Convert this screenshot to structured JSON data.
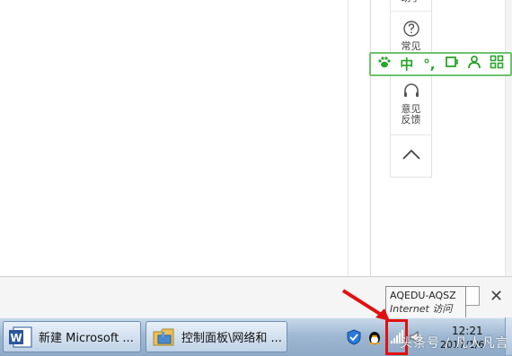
{
  "side_toolbar": {
    "top_partial_label": "助手",
    "faq_label": "常见",
    "feedback_label_line1": "意见",
    "feedback_label_line2": "反馈"
  },
  "ime_bar": {
    "items": [
      {
        "icon": "paw-icon",
        "text": "🐾"
      },
      {
        "icon": "chinese-mode",
        "text": "中"
      },
      {
        "icon": "punctuation-mode",
        "text": "°,"
      },
      {
        "icon": "skin-icon",
        "text": "☐"
      },
      {
        "icon": "user-icon",
        "text": "👤"
      },
      {
        "icon": "grid-icon",
        "text": "▦"
      }
    ]
  },
  "tooltip": {
    "line1": "AQEDU-AQSZ",
    "line2": "Internet 访问"
  },
  "taskbar": {
    "buttons": [
      {
        "label": "新建 Microsoft ...",
        "icon": "word-icon"
      },
      {
        "label": "控制面板\\网络和 ...",
        "icon": "control-panel-icon"
      }
    ],
    "clock_time": "12:21",
    "clock_date": "2017/1/6"
  },
  "notification": {
    "close_glyph": "✕"
  },
  "watermark": "头条号 / 凡人凡言",
  "colors": {
    "ime_green": "#2aa42a",
    "annotation_red": "#e01010"
  }
}
